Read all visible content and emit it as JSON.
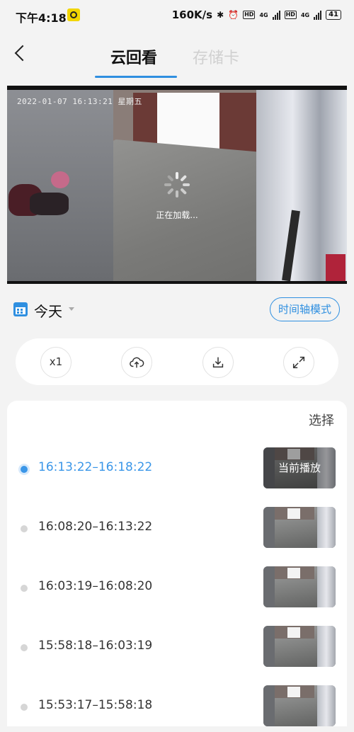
{
  "status_bar": {
    "time": "下午4:18",
    "net_speed": "160K/s",
    "hd1": "HD",
    "net1": "4G",
    "hd2": "HD",
    "net2": "4G",
    "battery": "41"
  },
  "header": {
    "tabs": [
      {
        "label": "云回看",
        "active": true
      },
      {
        "label": "存储卡",
        "active": false
      }
    ],
    "accent_color": "#2f8fe0"
  },
  "video": {
    "timestamp": "2022-01-07 16:13:21 星期五",
    "loading_text": "正在加载..."
  },
  "date_bar": {
    "date": "今天",
    "mode_button": "时间轴模式"
  },
  "toolbar": {
    "speed": "x1",
    "icons": [
      "cloud-upload-icon",
      "download-icon",
      "fullscreen-icon"
    ]
  },
  "records": {
    "select_label": "选择",
    "items": [
      {
        "time": "16:13:22–16:18:22",
        "active": true,
        "thumb_label": "当前播放"
      },
      {
        "time": "16:08:20–16:13:22",
        "active": false
      },
      {
        "time": "16:03:19–16:08:20",
        "active": false
      },
      {
        "time": "15:58:18–16:03:19",
        "active": false
      },
      {
        "time": "15:53:17–15:58:18",
        "active": false
      }
    ]
  }
}
